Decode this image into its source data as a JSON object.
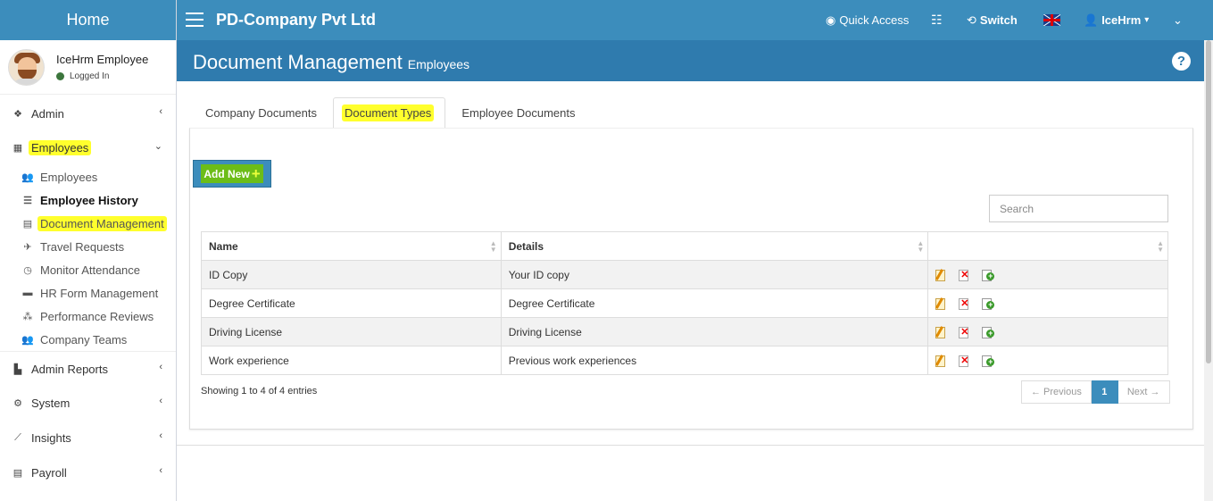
{
  "app": {
    "logo": "Home",
    "company": "PD-Company Pvt Ltd"
  },
  "user": {
    "name": "IceHrm Employee",
    "status": "Logged In"
  },
  "navbar": {
    "quick_access": "Quick Access",
    "switch": "Switch",
    "user_menu": "IceHrm",
    "user_caret": "▾",
    "language_flag": "uk-flag"
  },
  "sidebar": {
    "menus": [
      {
        "label": "Admin",
        "icon": "cubes-icon"
      },
      {
        "label": "Employees",
        "icon": "grid-icon",
        "expanded": true
      }
    ],
    "employee_submenu": [
      {
        "label": "Employees",
        "icon": "users-icon"
      },
      {
        "label": "Employee History",
        "icon": "list-icon",
        "active": true
      },
      {
        "label": "Document Management",
        "icon": "file-icon",
        "highlighted": true
      },
      {
        "label": "Travel Requests",
        "icon": "plane-icon"
      },
      {
        "label": "Monitor Attendance",
        "icon": "clock-icon"
      },
      {
        "label": "HR Form Management",
        "icon": "folder-icon"
      },
      {
        "label": "Performance Reviews",
        "icon": "sitemap-icon"
      },
      {
        "label": "Company Teams",
        "icon": "users-icon"
      }
    ],
    "lower_menus": [
      {
        "label": "Admin Reports",
        "icon": "reports-icon"
      },
      {
        "label": "System",
        "icon": "cogs-icon"
      },
      {
        "label": "Insights",
        "icon": "chart-icon"
      },
      {
        "label": "Payroll",
        "icon": "file-icon"
      }
    ]
  },
  "header": {
    "title": "Document Management",
    "subtitle": "Employees",
    "help": "?"
  },
  "tabs": [
    {
      "label": "Company Documents"
    },
    {
      "label": "Document Types",
      "active": true
    },
    {
      "label": "Employee Documents"
    }
  ],
  "toolbar": {
    "add_new": "Add New",
    "add_icon": "+"
  },
  "search": {
    "placeholder": "Search",
    "value": ""
  },
  "table": {
    "columns": [
      "Name",
      "Details",
      ""
    ],
    "rows": [
      {
        "name": "ID Copy",
        "details": "Your ID copy"
      },
      {
        "name": "Degree Certificate",
        "details": "Degree Certificate"
      },
      {
        "name": "Driving License",
        "details": "Driving License"
      },
      {
        "name": "Work experience",
        "details": "Previous work experiences"
      }
    ]
  },
  "pagination": {
    "info": "Showing 1 to 4 of 4 entries",
    "previous": "← Previous",
    "page": "1",
    "next": "Next →"
  },
  "colors": {
    "primary": "#3c8dbc",
    "header": "#2f7bae",
    "highlight": "#ffff2d",
    "add_button": "#6cbd18"
  }
}
